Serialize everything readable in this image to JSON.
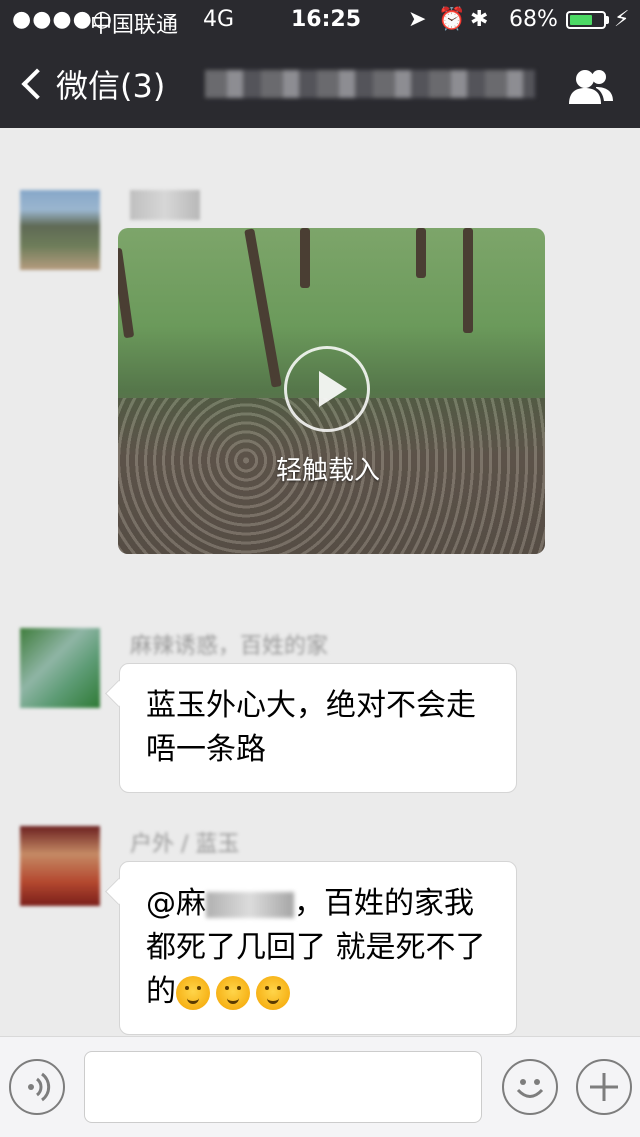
{
  "status_bar": {
    "signal": "●●●●○",
    "carrier": "中国联通",
    "network": "4G",
    "time": "16:25",
    "location_icon": "location-arrow-icon",
    "alarm_icon": "alarm-clock-icon",
    "bluetooth_icon": "bluetooth-icon",
    "battery_percent": "68%",
    "battery_level": 0.68,
    "battery_color": "#4cd964"
  },
  "nav": {
    "back_label": "微信(3)",
    "title": "",
    "group_icon": "group-members-icon"
  },
  "messages": [
    {
      "sender": "",
      "type": "video",
      "video_label": "轻触载入"
    },
    {
      "sender": "麻辣诱惑，百姓的家",
      "type": "text",
      "text": "蓝玉外心大，绝对不会走唔一条路"
    },
    {
      "sender": "户外 / 蓝玉",
      "type": "text",
      "text_prefix": "@麻",
      "text_suffix": "，百姓的家我都死了几回了 就是死不了的",
      "emoji_name": "thinking-face-emoji"
    }
  ],
  "input_bar": {
    "voice_icon": "voice-input-icon",
    "emoji_icon": "emoji-icon",
    "plus_icon": "plus-icon"
  }
}
